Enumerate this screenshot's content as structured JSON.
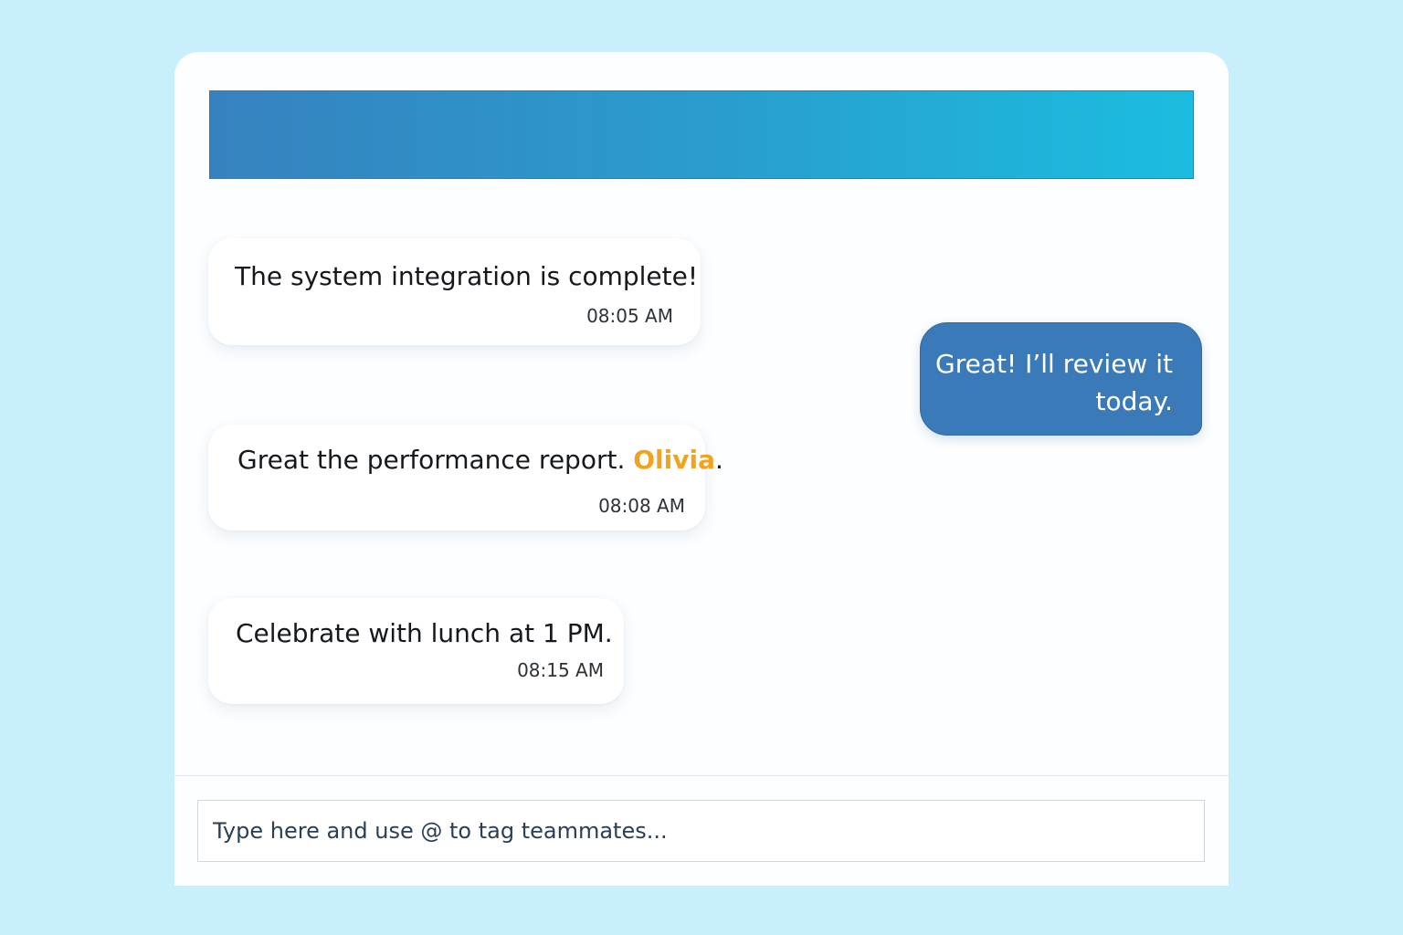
{
  "colors": {
    "page_background": "#c9eefc",
    "header_gradient_start": "#3682bf",
    "header_gradient_end": "#1bbde0",
    "outgoing_bubble": "#3a7ab9",
    "mention": "#f0a41e"
  },
  "messages": [
    {
      "direction": "incoming",
      "text": "The system integration is complete!",
      "time": "08:05 AM"
    },
    {
      "direction": "outgoing",
      "text": "Great! I’ll review it today."
    },
    {
      "direction": "incoming",
      "text_before": "Great the performance report. ",
      "mention": "Olivia",
      "text_after": ".",
      "time": "08:08 AM"
    },
    {
      "direction": "incoming",
      "text": "Celebrate with lunch at 1 PM.",
      "time": "08:15 AM"
    }
  ],
  "composer": {
    "placeholder": "Type here and use @ to tag teammates..."
  }
}
